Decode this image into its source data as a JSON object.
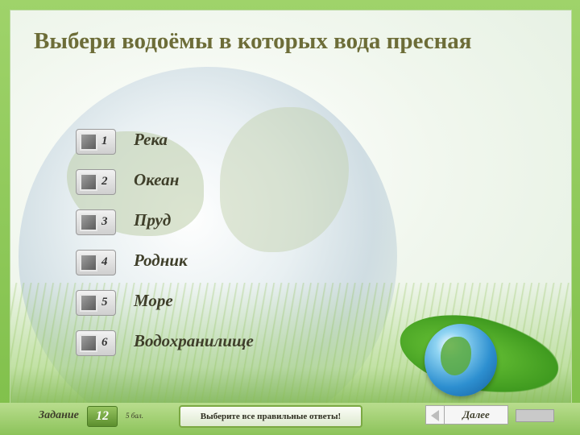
{
  "question": {
    "title": "Выбери водоёмы в которых вода пресная"
  },
  "options": [
    {
      "number": "1",
      "label": "Река"
    },
    {
      "number": "2",
      "label": "Океан"
    },
    {
      "number": "3",
      "label": "Пруд"
    },
    {
      "number": "4",
      "label": "Родник"
    },
    {
      "number": "5",
      "label": "Море"
    },
    {
      "number": "6",
      "label": "Водохранилище"
    }
  ],
  "footer": {
    "task_label": "Задание",
    "task_number": "12",
    "points": "5 бал.",
    "hint": "Выберите все правильные ответы!",
    "next_label": "Далее",
    "back_icon": "back-arrow-icon"
  },
  "colors": {
    "frame_green": "#8cc35a",
    "title_olive": "#6d6d38",
    "hint_border": "#7ba843"
  }
}
